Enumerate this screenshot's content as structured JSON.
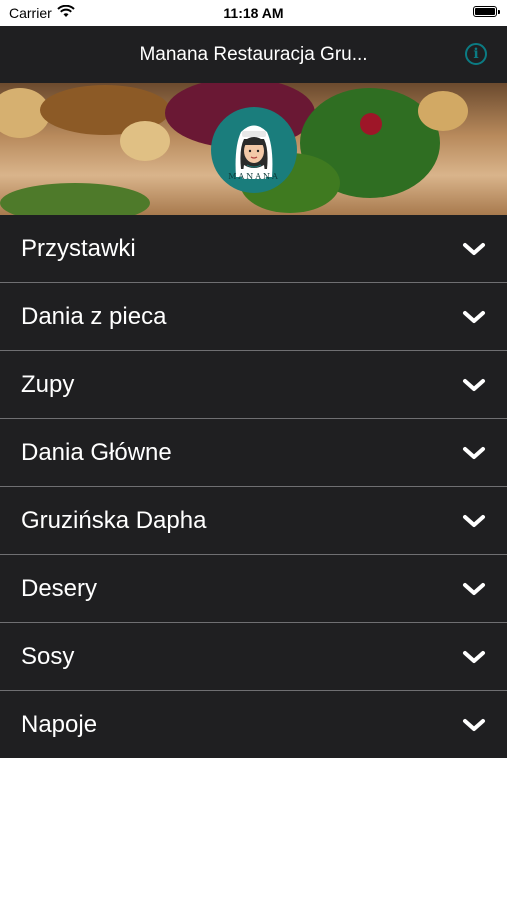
{
  "status_bar": {
    "carrier": "Carrier",
    "time": "11:18 AM"
  },
  "nav": {
    "title": "Manana Restauracja Gru...",
    "info_icon": "info-icon"
  },
  "banner": {
    "logo_text": "MANANA"
  },
  "menu": {
    "items": [
      {
        "label": "Przystawki"
      },
      {
        "label": "Dania z pieca"
      },
      {
        "label": "Zupy"
      },
      {
        "label": "Dania Główne"
      },
      {
        "label": "Gruzińska Dapha"
      },
      {
        "label": "Desery"
      },
      {
        "label": "Sosy"
      },
      {
        "label": "Napoje"
      }
    ]
  },
  "colors": {
    "nav_background": "#1f1f21",
    "accent": "#0b7b83",
    "separator": "#6f6f72"
  }
}
